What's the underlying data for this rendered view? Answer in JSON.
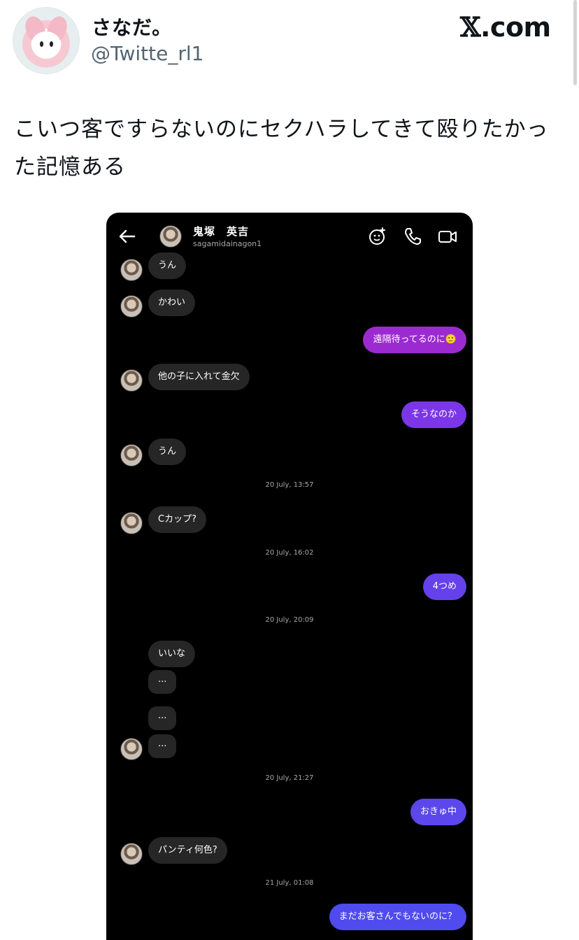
{
  "tweet": {
    "display_name": "さなだ。",
    "handle": "@Twitte_rl1",
    "brand": "X.com",
    "brand_x": "𝕏",
    "brand_rest": ".com",
    "text": "こいつ客ですらないのにセクハラしてきて殴りたかった記憶ある"
  },
  "dm": {
    "contact_name": "鬼塚　英吉",
    "contact_username": "sagamidainagon1",
    "header_icons": [
      "back-arrow-icon",
      "sticker-effect-icon",
      "phone-icon",
      "video-icon"
    ],
    "accent_colors": {
      "purple": "#9b2bd0",
      "violet": "#7b36e8",
      "indigo": "#5b47ec"
    },
    "messages": [
      {
        "side": "in",
        "text": "うん"
      },
      {
        "side": "in",
        "text": "かわい"
      },
      {
        "side": "out",
        "text": "遠隔待ってるのに🙂"
      },
      {
        "side": "in",
        "text": "他の子に入れて金欠"
      },
      {
        "side": "out",
        "text": "そうなのか"
      },
      {
        "side": "in",
        "text": "うん"
      },
      {
        "side": "time",
        "text": "20 July, 13:57"
      },
      {
        "side": "in",
        "text": "Cカップ?"
      },
      {
        "side": "time",
        "text": "20 July, 16:02"
      },
      {
        "side": "out",
        "text": "4つめ"
      },
      {
        "side": "time",
        "text": "20 July, 20:09"
      },
      {
        "side": "in",
        "text": "いいな"
      },
      {
        "side": "in",
        "text": "..."
      },
      {
        "side": "in",
        "text": "..."
      },
      {
        "side": "in",
        "text": "..."
      },
      {
        "side": "time",
        "text": "20 July, 21:27"
      },
      {
        "side": "out",
        "text": "おきゅ中"
      },
      {
        "side": "in",
        "text": "パンティ何色?"
      },
      {
        "side": "time",
        "text": "21 July, 01:08"
      },
      {
        "side": "out",
        "text": "まだお客さんでもないのに？"
      }
    ]
  }
}
